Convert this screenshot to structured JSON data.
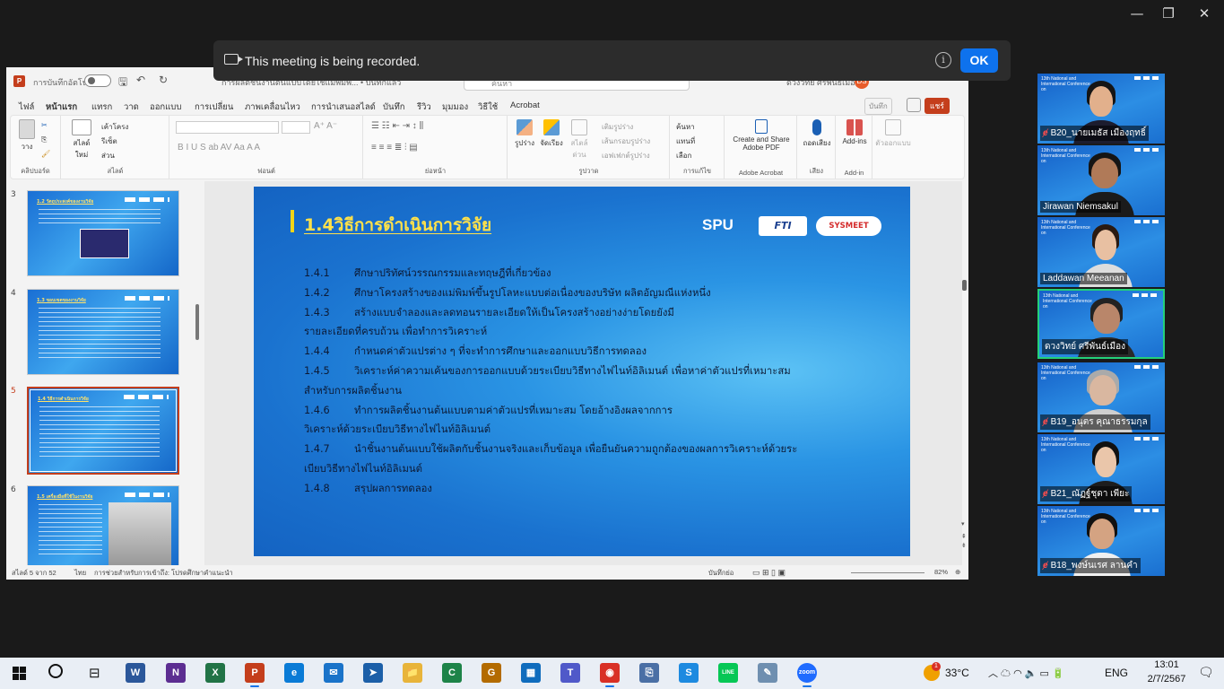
{
  "window": {
    "minimize": "—",
    "restore": "❐",
    "close": "✕"
  },
  "banner": {
    "message": "This meeting is being recorded.",
    "info": "i",
    "ok_label": "OK"
  },
  "ppt": {
    "app_icon": "P",
    "autosave_label": "การบันทึกอัตโนมัติ",
    "doc_title": "การผลิตชิ้นงานต้นแบบโดยใช้แม่พิมพ์...  •  บันทึกแล้ว",
    "search_placeholder": "ค้นหา",
    "user_name": "ดวงวิทย์ ศรีพันธ์เมือง",
    "user_initials": "DS",
    "tabs": [
      "ไฟล์",
      "หน้าแรก",
      "แทรก",
      "วาด",
      "ออกแบบ",
      "การเปลี่ยน",
      "ภาพเคลื่อนไหว",
      "การนำเสนอสไลด์",
      "บันทึก",
      "รีวิว",
      "มุมมอง",
      "วิธีใช้",
      "Acrobat"
    ],
    "save_btn": "บันทึก",
    "share_btn": "แชร์",
    "ribbon": {
      "paste": "วาง",
      "clipboard": "คลิปบอร์ด",
      "new_slide": "สไลด์ใหม่",
      "layout": "เค้าโครง",
      "reset": "รีเซ็ต",
      "section": "ส่วน",
      "slides_group": "สไลด์",
      "font_group": "ฟอนต์",
      "paragraph_group": "ย่อหน้า",
      "shapes": "รูปร่าง",
      "arrange": "จัดเรียง",
      "quick_styles": "สไตล์ด่วน",
      "shape_fill": "เติมรูปร่าง",
      "shape_outline": "เส้นกรอบรูปร่าง",
      "shape_effects": "เอฟเฟกต์รูปร่าง",
      "drawing_group": "รูปวาด",
      "find": "ค้นหา",
      "replace": "แทนที่",
      "select": "เลือก",
      "editing_group": "การแก้ไข",
      "adobe_btn": "Create and Share Adobe PDF",
      "adobe_group": "Adobe Acrobat",
      "dictate": "ถอดเสียง",
      "voice_group": "เสียง",
      "addins": "Add-ins",
      "addins_group": "Add-in",
      "designer": "ตัวออกแบบ"
    },
    "thumbnails": [
      {
        "num": "3",
        "title": "1.2 วัตถุประสงค์ของงานวิจัย"
      },
      {
        "num": "4",
        "title": "1.3 ขอบเขตของงานวิจัย"
      },
      {
        "num": "5",
        "title": "1.4 วิธีการดำเนินการวิจัย"
      },
      {
        "num": "6",
        "title": "1.5 เครื่องมือที่ใช้ในงานวิจัย"
      }
    ],
    "slide": {
      "title": "1.4วิธีการดำเนินการวิจัย",
      "logos": [
        "SPU",
        "FTI",
        "SYSMEET"
      ],
      "items": [
        {
          "n": "1.4.1",
          "t": "ศึกษาปริทัศน์วรรณกรรมและทฤษฎีที่เกี่ยวข้อง"
        },
        {
          "n": "1.4.2",
          "t": "ศึกษาโครงสร้างของแม่พิมพ์ขึ้นรูปโลหะแบบต่อเนื่องของบริษัท ผลิตอัญมณีแห่งหนึ่ง"
        },
        {
          "n": "1.4.3",
          "t": "สร้างแบบจำลองและลดทอนรายละเอียดให้เป็นโครงสร้างอย่างง่ายโดยยังมี"
        },
        {
          "n": "",
          "t": "รายละเอียดที่ครบถ้วน เพื่อทำการวิเคราะห์"
        },
        {
          "n": "1.4.4",
          "t": "กำหนดค่าตัวแปรต่าง ๆ ที่จะทำการศึกษาและออกแบบวิธีการทดลอง"
        },
        {
          "n": "1.4.5",
          "t": "วิเคราะห์ค่าความเค้นของการออกแบบด้วยระเบียบวิธีทางไฟไนท์อิลิเมนต์ เพื่อหาค่าตัวแปรที่เหมาะสม"
        },
        {
          "n": "",
          "t": "สำหรับการผลิตชิ้นงาน"
        },
        {
          "n": "1.4.6",
          "t": "ทำการผลิตชิ้นงานต้นแบบตามค่าตัวแปรที่เหมาะสม โดยอ้างอิงผลจากการ"
        },
        {
          "n": "",
          "t": "วิเคราะห์ด้วยระเบียบวิธีทางไฟไนท์อิลิเมนต์"
        },
        {
          "n": "1.4.7",
          "t": "นำชิ้นงานต้นแบบใช้ผลิตกับชิ้นงานจริงและเก็บข้อมูล เพื่อยืนยันความถูกต้องของผลการวิเคราะห์ด้วยระ"
        },
        {
          "n": "",
          "t": "เบียบวิธีทางไฟไนท์อิลิเมนต์"
        },
        {
          "n": "1.4.8",
          "t": "สรุปผลการทดลอง"
        }
      ]
    },
    "status": {
      "slide_count": "สไลด์ 5 จาก 52",
      "language": "ไทย",
      "accessibility": "การช่วยสำหรับการเข้าถึง: โปรดศึกษาคำแนะนำ",
      "notes": "บันทึกย่อ",
      "zoom": "82%"
    }
  },
  "participants": [
    {
      "name": "B20_นายเมธัส เมืองฤทธิ์",
      "muted": true
    },
    {
      "name": "Jirawan Niemsakul",
      "muted": false
    },
    {
      "name": "Laddawan Meeanan",
      "muted": false
    },
    {
      "name": "ดวงวิทย์ ศรีพันธ์เมือง",
      "muted": false
    },
    {
      "name": "B19_อนุตร คุณาธรรมกุล",
      "muted": true
    },
    {
      "name": "B21_ณัฏฐ์ชุดา เพียะ",
      "muted": true
    },
    {
      "name": "B18_พงษ์นเรศ ลานคำ",
      "muted": true
    }
  ],
  "conf_text": "13th National and International Conference on",
  "taskbar": {
    "apps": [
      "W",
      "N",
      "X",
      "P",
      "e",
      "✉",
      "➤",
      "📁",
      "C",
      "G",
      "▦",
      "T",
      "◉",
      "⎘",
      "S",
      "LINE",
      "✎",
      "zoom"
    ],
    "weather": "33°C",
    "weather_badge": "1",
    "lang": "ENG",
    "time": "13:01",
    "date": "2/7/2567"
  }
}
